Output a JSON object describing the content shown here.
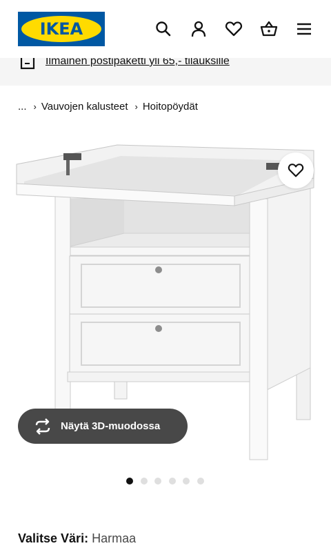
{
  "header": {
    "logo_text": "IKEA",
    "icons": [
      "search-icon",
      "account-icon",
      "heart-icon",
      "cart-icon",
      "menu-icon"
    ],
    "brand_blue": "#0058a3",
    "brand_yellow": "#ffdb00"
  },
  "banner": {
    "text": "Ilmainen postipaketti yli 65,- tilauksille"
  },
  "breadcrumb": {
    "items": [
      "...",
      "Vauvojen kalusteet",
      "Hoitopöydät"
    ]
  },
  "gallery": {
    "view_3d_label": "Näytä 3D-muodossa",
    "dot_count": 6,
    "active_dot": 0
  },
  "color": {
    "label": "Valitse Väri:",
    "value": "Harmaa"
  }
}
